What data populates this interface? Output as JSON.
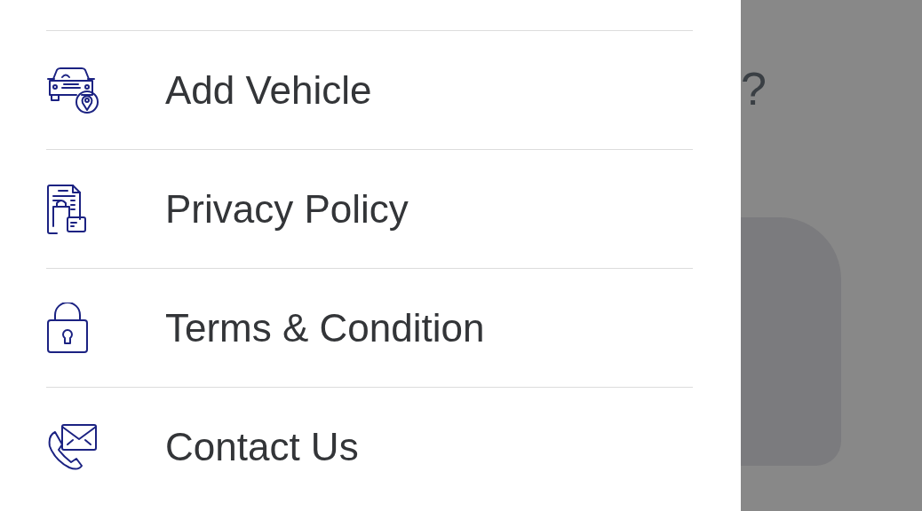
{
  "menu": {
    "items": [
      {
        "kind": "vehicle",
        "label": "Add Vehicle"
      },
      {
        "kind": "privacy",
        "label": "Privacy Policy"
      },
      {
        "kind": "terms",
        "label": "Terms & Condition"
      },
      {
        "kind": "contact",
        "label": "Contact Us"
      }
    ]
  },
  "background": {
    "heading": "?"
  }
}
